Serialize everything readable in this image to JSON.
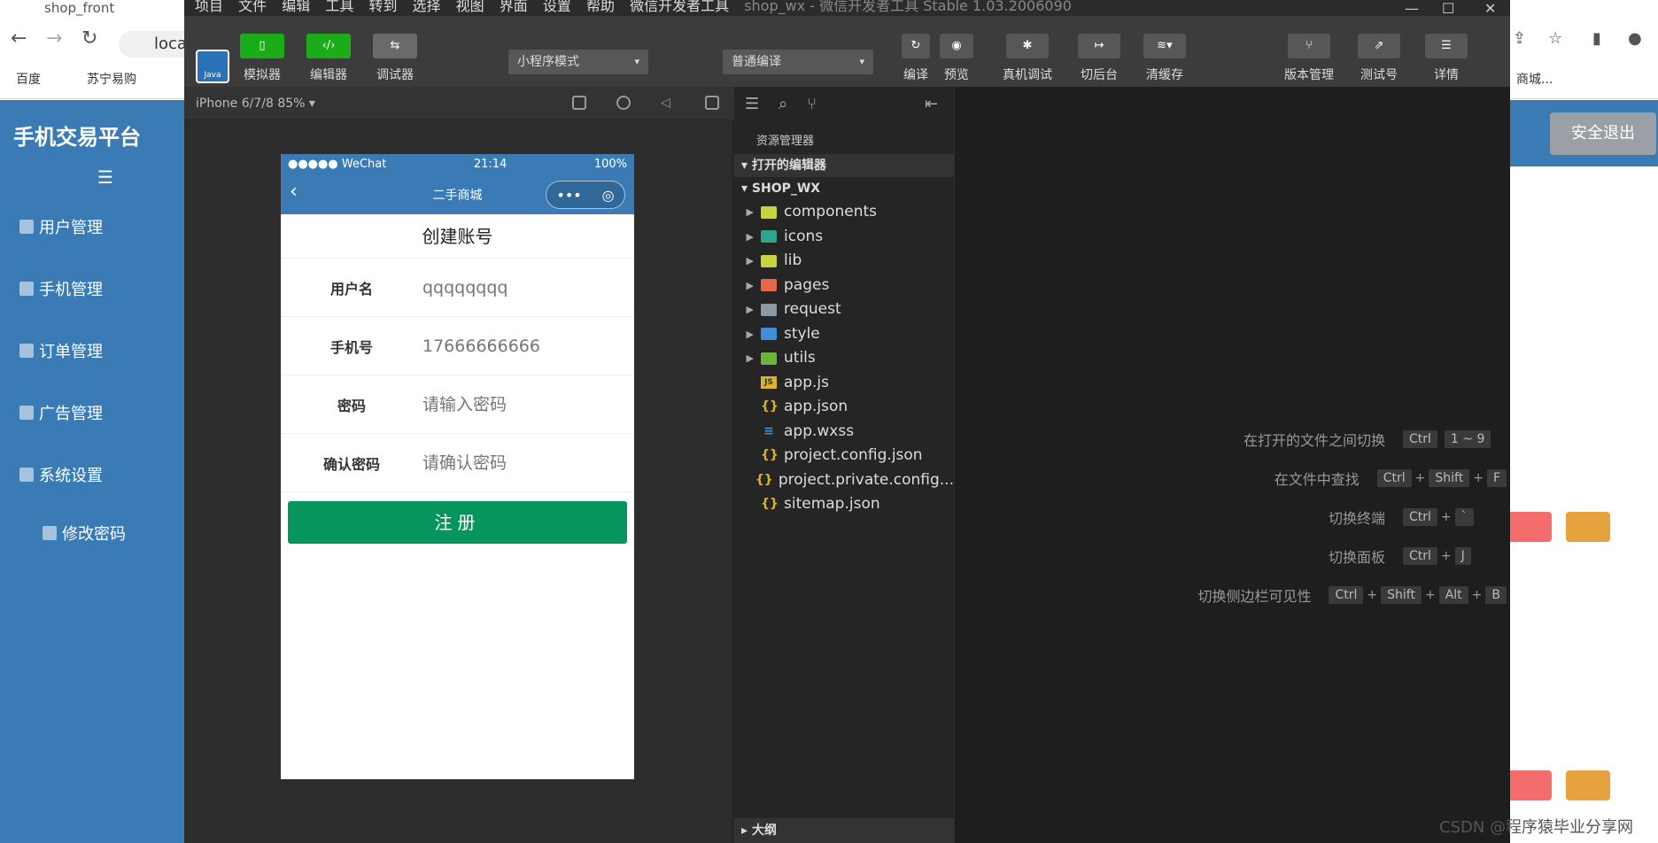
{
  "browser": {
    "tab_title": "shop_front",
    "url": "loca",
    "bookmarks": [
      "百度",
      "苏宁易购",
      "商城..."
    ]
  },
  "admin": {
    "title": "手机交易平台",
    "menu": [
      "用户管理",
      "手机管理",
      "订单管理",
      "广告管理",
      "系统设置",
      "修改密码"
    ],
    "logout": "安全退出"
  },
  "devtools": {
    "menubar": [
      "项目",
      "文件",
      "编辑",
      "工具",
      "转到",
      "选择",
      "视图",
      "界面",
      "设置",
      "帮助",
      "微信开发者工具"
    ],
    "window_title": "shop_wx - 微信开发者工具 Stable 1.03.2006090",
    "avatar_text": "Java",
    "toolbar": {
      "simulator": "模拟器",
      "editor": "编辑器",
      "debugger": "调试器",
      "mode": "小程序模式",
      "compile_mode": "普通编译",
      "compile": "编译",
      "preview": "预览",
      "real_debug": "真机调试",
      "background": "切后台",
      "clear_cache": "清缓存",
      "version": "版本管理",
      "test": "测试号",
      "details": "详情"
    },
    "device": "iPhone 6/7/8 85% ▾"
  },
  "phone": {
    "status": {
      "carrier": "●●●●● WeChat",
      "time": "21:14",
      "battery": "100%"
    },
    "nav_title": "二手商城",
    "form_title": "创建账号",
    "fields": [
      {
        "label": "用户名",
        "value": "qqqqqqqq"
      },
      {
        "label": "手机号",
        "value": "17666666666"
      },
      {
        "label": "密码",
        "value": "请输入密码"
      },
      {
        "label": "确认密码",
        "value": "请确认密码"
      }
    ],
    "register": "注册"
  },
  "explorer": {
    "header": "资源管理器",
    "open_editors": "打开的编辑器",
    "project": "SHOP_WX",
    "folders": [
      "components",
      "icons",
      "lib",
      "pages",
      "request",
      "style",
      "utils"
    ],
    "files": [
      "app.js",
      "app.json",
      "app.wxss",
      "project.config.json",
      "project.private.config...",
      "sitemap.json"
    ],
    "outline": "大纲"
  },
  "shortcuts": [
    {
      "desc": "在打开的文件之间切换",
      "keys": [
        "Ctrl",
        "1 ~ 9"
      ]
    },
    {
      "desc": "在文件中查找",
      "keys": [
        "Ctrl",
        "Shift",
        "F"
      ]
    },
    {
      "desc": "切换终端",
      "keys": [
        "Ctrl",
        "`"
      ]
    },
    {
      "desc": "切换面板",
      "keys": [
        "Ctrl",
        "J"
      ]
    },
    {
      "desc": "切换侧边栏可见性",
      "keys": [
        "Ctrl",
        "Shift",
        "Alt",
        "B"
      ]
    }
  ],
  "watermark": "CSDN @程序猿毕业分享网",
  "colors": {
    "wechat_green": "#1aad19",
    "register_green": "#07955e",
    "admin_blue": "#3a7bb5"
  }
}
